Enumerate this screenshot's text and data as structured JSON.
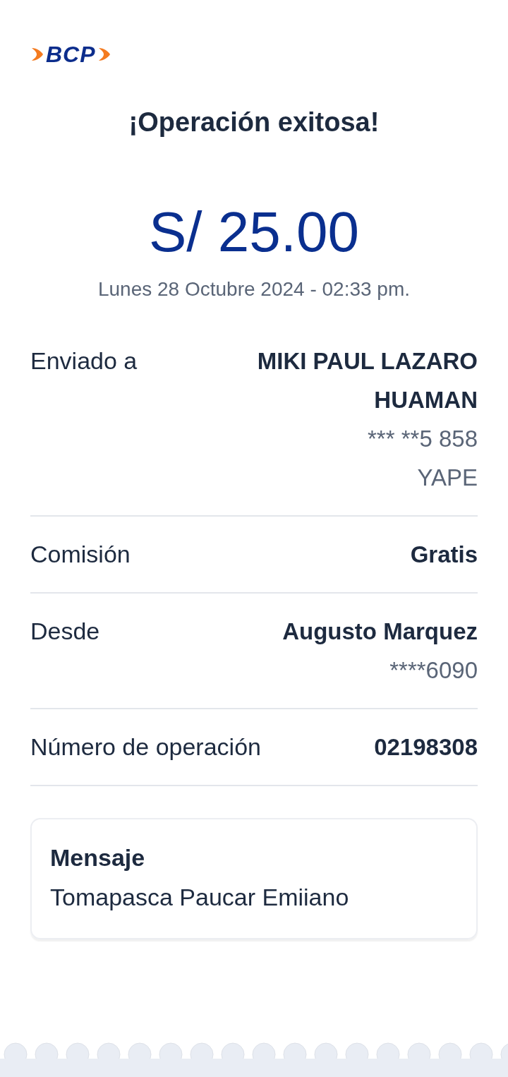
{
  "logo": {
    "text": "BCP"
  },
  "title": "¡Operación exitosa!",
  "amount": "S/ 25.00",
  "datetime": "Lunes 28 Octubre 2024 - 02:33 pm.",
  "details": [
    {
      "label": "Enviado a",
      "value": "MIKI PAUL LAZARO HUAMAN",
      "sub": [
        "*** **5 858",
        "YAPE"
      ]
    },
    {
      "label": "Comisión",
      "value": "Gratis"
    },
    {
      "label": "Desde",
      "value": "Augusto Marquez",
      "sub": [
        "****6090"
      ]
    },
    {
      "label": "Número de operación",
      "value": "02198308"
    }
  ],
  "message": {
    "title": "Mensaje",
    "text": "Tomapasca Paucar Emiiano"
  }
}
